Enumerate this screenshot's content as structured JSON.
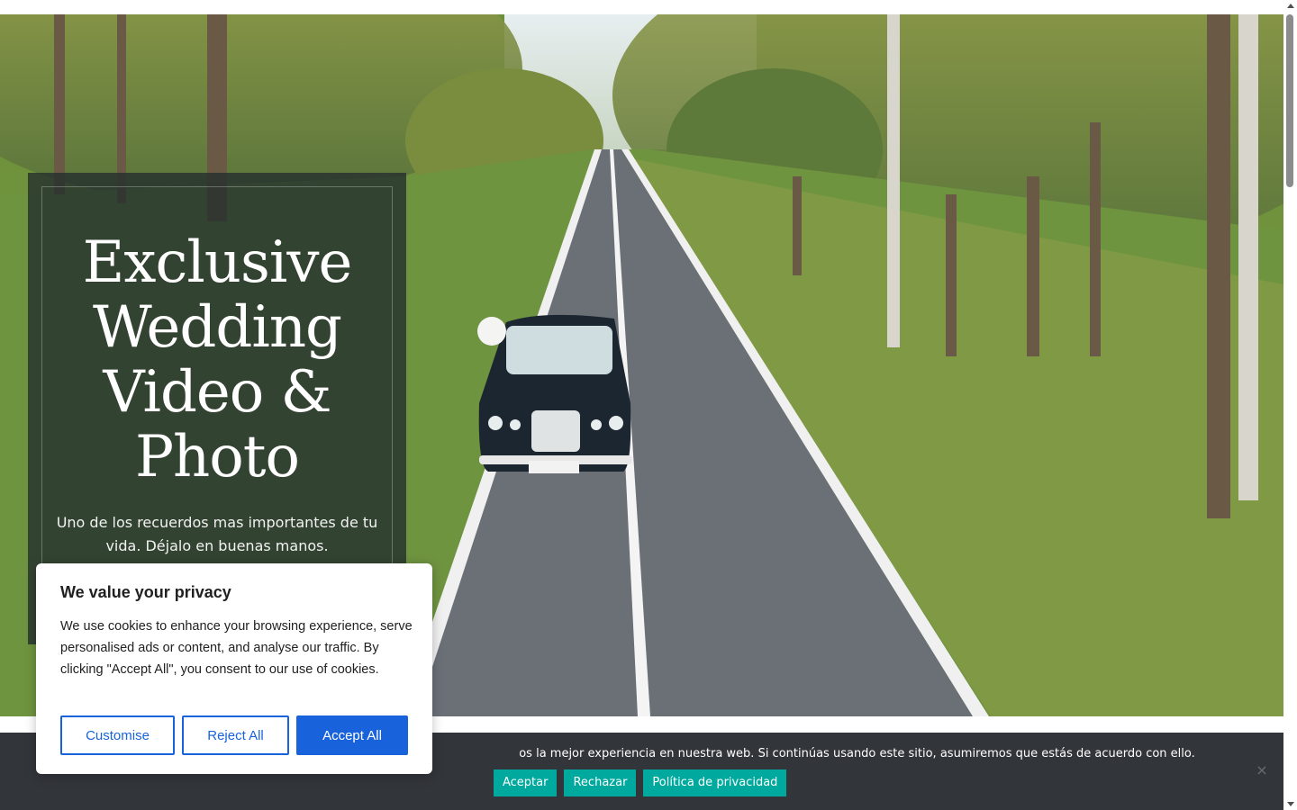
{
  "hero": {
    "title_lines": [
      "Exclusive",
      "Wedding",
      "Video &",
      "Photo"
    ],
    "subtitle": "Uno de los recuerdos mas importantes de tu vida. Déjalo en buenas manos."
  },
  "cookie_bar": {
    "text": "os la mejor experiencia en nuestra web. Si continúas usando este sitio, asumiremos que estás de acuerdo con ello.",
    "accept_label": "Aceptar",
    "reject_label": "Rechazar",
    "privacy_label": "Política de privacidad",
    "close_icon": "×",
    "button_color": "#00a99d"
  },
  "privacy_modal": {
    "title": "We value your privacy",
    "body": "We use cookies to enhance your browsing experience, serve personalised ads or content, and analyse our traffic. By clicking \"Accept All\", you consent to our use of cookies.",
    "customise_label": "Customise",
    "reject_label": "Reject All",
    "accept_label": "Accept All",
    "accent_color": "#1863dc"
  }
}
